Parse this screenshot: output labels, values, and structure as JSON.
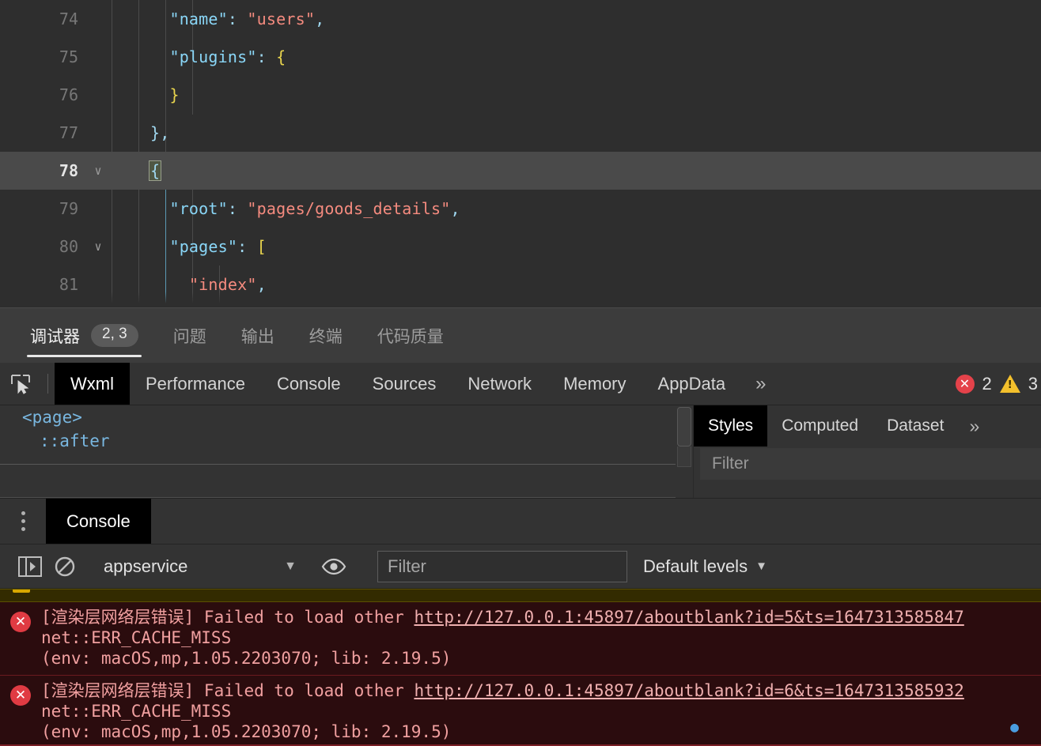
{
  "editor": {
    "lines": [
      {
        "number": "74",
        "fold": "",
        "active": false,
        "indent_guides": 2,
        "tokens": [
          {
            "t": "\"name\"",
            "c": "key"
          },
          {
            "t": ": ",
            "c": "punct"
          },
          {
            "t": "\"users\"",
            "c": "str"
          },
          {
            "t": ",",
            "c": "punct"
          }
        ],
        "indent": 3
      },
      {
        "number": "75",
        "fold": "",
        "active": false,
        "indent_guides": 2,
        "tokens": [
          {
            "t": "\"plugins\"",
            "c": "key"
          },
          {
            "t": ": ",
            "c": "punct"
          },
          {
            "t": "{",
            "c": "brace"
          }
        ],
        "indent": 3
      },
      {
        "number": "76",
        "fold": "",
        "active": false,
        "indent_guides": 2,
        "tokens": [
          {
            "t": "}",
            "c": "brace"
          }
        ],
        "indent": 3
      },
      {
        "number": "77",
        "fold": "",
        "active": false,
        "indent_guides": 1,
        "tokens": [
          {
            "t": "},",
            "c": "punct"
          }
        ],
        "indent": 2
      },
      {
        "number": "78",
        "fold": "chevron-down",
        "active": true,
        "indent_guides": 1,
        "tokens": [
          {
            "t": "{",
            "c": "bracketmatch"
          }
        ],
        "indent": 2
      },
      {
        "number": "79",
        "fold": "",
        "active": false,
        "indent_guides": 2,
        "tokens": [
          {
            "t": "\"root\"",
            "c": "key"
          },
          {
            "t": ": ",
            "c": "punct"
          },
          {
            "t": "\"pages/goods_details\"",
            "c": "str"
          },
          {
            "t": ",",
            "c": "punct"
          }
        ],
        "indent": 3
      },
      {
        "number": "80",
        "fold": "chevron-down",
        "active": false,
        "indent_guides": 2,
        "tokens": [
          {
            "t": "\"pages\"",
            "c": "key"
          },
          {
            "t": ": ",
            "c": "punct"
          },
          {
            "t": "[",
            "c": "brace"
          }
        ],
        "indent": 3
      },
      {
        "number": "81",
        "fold": "",
        "active": false,
        "indent_guides": 3,
        "tokens": [
          {
            "t": "\"index\"",
            "c": "str"
          },
          {
            "t": ",",
            "c": "punct"
          }
        ],
        "indent": 4
      }
    ]
  },
  "ide_tabs": {
    "items": [
      {
        "label": "调试器",
        "badge": "2, 3",
        "active": true
      },
      {
        "label": "问题",
        "badge": "",
        "active": false
      },
      {
        "label": "输出",
        "badge": "",
        "active": false
      },
      {
        "label": "终端",
        "badge": "",
        "active": false
      },
      {
        "label": "代码质量",
        "badge": "",
        "active": false
      }
    ]
  },
  "devtools": {
    "picker_icon": "inspect-element-icon",
    "tabs": [
      {
        "label": "Wxml",
        "active": true
      },
      {
        "label": "Performance",
        "active": false
      },
      {
        "label": "Console",
        "active": false
      },
      {
        "label": "Sources",
        "active": false
      },
      {
        "label": "Network",
        "active": false
      },
      {
        "label": "Memory",
        "active": false
      },
      {
        "label": "AppData",
        "active": false
      }
    ],
    "more_label": "»",
    "error_count": "2",
    "warning_count": "3",
    "error_icon": "error-circle-icon",
    "warning_icon": "warning-triangle-icon"
  },
  "element_tree": {
    "nodes": [
      {
        "text": "<page>",
        "indent": 0
      },
      {
        "text": "::after",
        "indent": 1
      }
    ]
  },
  "styles_panel": {
    "tabs": [
      {
        "label": "Styles",
        "active": true
      },
      {
        "label": "Computed",
        "active": false
      },
      {
        "label": "Dataset",
        "active": false
      }
    ],
    "more_label": "»",
    "filter_placeholder": "Filter"
  },
  "drawer": {
    "menu_icon": "kebab-menu-icon",
    "tabs": [
      {
        "label": "Console",
        "active": true
      }
    ],
    "toolbar": {
      "sidebar_icon": "console-sidebar-icon",
      "clear_icon": "clear-console-icon",
      "eye_icon": "live-expression-icon",
      "context": "appservice",
      "context_caret": "▼",
      "filter_placeholder": "Filter",
      "levels_label": "Default levels",
      "levels_caret": "▼"
    }
  },
  "console_messages": [
    {
      "level": "warning",
      "partial": true,
      "text": ""
    },
    {
      "level": "error",
      "icon": "error-circle-icon",
      "prefix": "[渲染层网络层错误] Failed to load other ",
      "url": "http://127.0.0.1:45897/aboutblank?id=5&ts=1647313585847",
      "line2": "net::ERR_CACHE_MISS",
      "line3": "(env: macOS,mp,1.05.2203070; lib: 2.19.5)"
    },
    {
      "level": "error",
      "icon": "error-circle-icon",
      "prefix": "[渲染层网络层错误] Failed to load other ",
      "url": "http://127.0.0.1:45897/aboutblank?id=6&ts=1647313585932",
      "line2": "net::ERR_CACHE_MISS",
      "line3": "(env: macOS,mp,1.05.2203070; lib: 2.19.5)"
    }
  ],
  "colors": {
    "editor_bg": "#2e2e2e",
    "active_line": "#4a4a4a",
    "key": "#8ad7f8",
    "string": "#f58b7f",
    "brace": "#e8d44d",
    "error_bg": "#2b0c0e",
    "error_red": "#e03b43",
    "warning_yellow": "#f3c02c",
    "toolbar_bg": "#333333"
  }
}
